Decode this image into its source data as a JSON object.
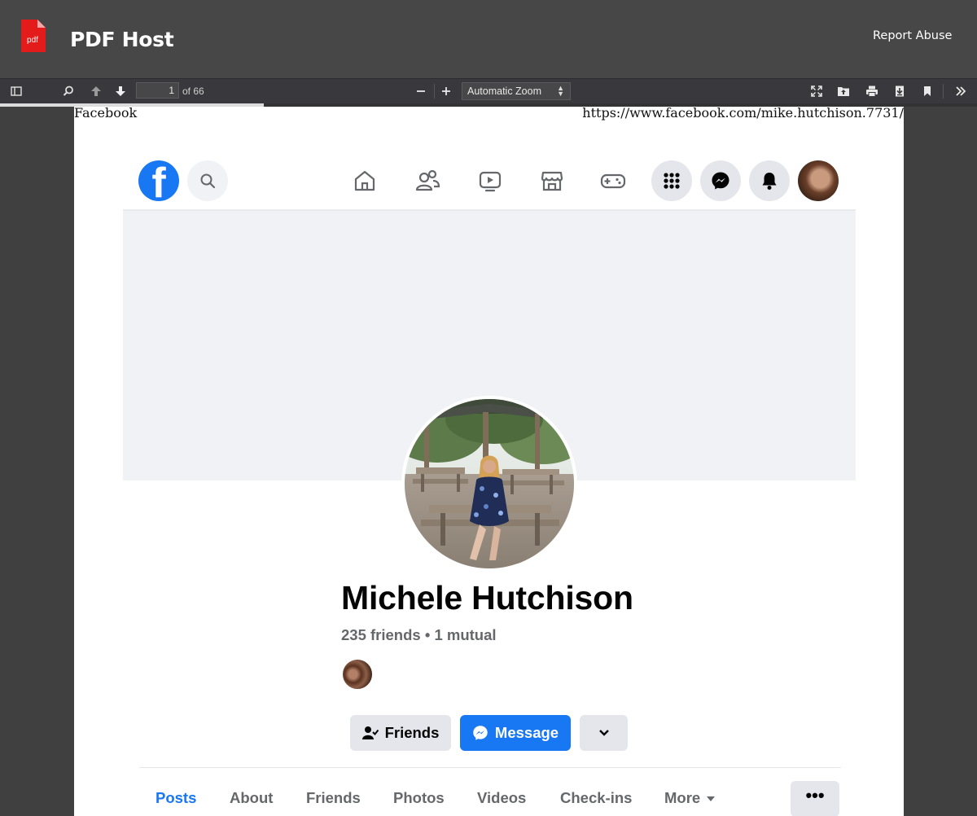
{
  "app": {
    "brand": "PDF Host",
    "report_link": "Report Abuse",
    "logo_text": "pdf"
  },
  "toolbar": {
    "page_current": "1",
    "page_total": "of 66",
    "zoom": "Automatic Zoom",
    "progress_fraction": 0.27
  },
  "document": {
    "header_left": "Facebook",
    "header_right": "https://www.facebook.com/mike.hutchison.7731/"
  },
  "facebook": {
    "logo_letter": "f",
    "profile": {
      "name": "Michele Hutchison",
      "friends_summary": "235 friends • 1 mutual"
    },
    "actions": {
      "friends": "Friends",
      "message": "Message"
    },
    "tabs": [
      {
        "label": "Posts"
      },
      {
        "label": "About"
      },
      {
        "label": "Friends"
      },
      {
        "label": "Photos"
      },
      {
        "label": "Videos"
      },
      {
        "label": "Check-ins"
      },
      {
        "label": "More"
      }
    ],
    "menu_dots": "•••",
    "accent": "#1877f2"
  }
}
